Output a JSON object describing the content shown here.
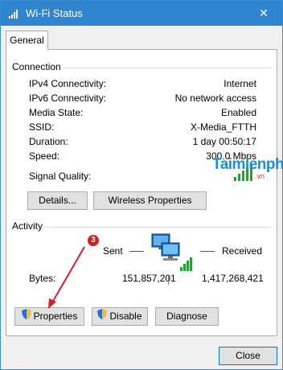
{
  "window": {
    "title": "Wi-Fi Status",
    "close_glyph": "✕"
  },
  "tabs": [
    {
      "label": "General"
    }
  ],
  "connection": {
    "heading": "Connection",
    "rows": [
      {
        "label": "IPv4 Connectivity:",
        "value": "Internet"
      },
      {
        "label": "IPv6 Connectivity:",
        "value": "No network access"
      },
      {
        "label": "Media State:",
        "value": "Enabled"
      },
      {
        "label": "SSID:",
        "value": "X-Media_FTTH"
      },
      {
        "label": "Duration:",
        "value": "1 day 00:50:17"
      },
      {
        "label": "Speed:",
        "value": "300.0 Mbps"
      }
    ],
    "signal_label": "Signal Quality:",
    "signal_bars": 5,
    "details_button": "Details...",
    "wireless_properties_button": "Wireless Properties"
  },
  "activity": {
    "heading": "Activity",
    "sent_label": "Sent",
    "received_label": "Received",
    "bytes_label": "Bytes:",
    "bytes_sent": "151,857,201",
    "bytes_received": "1,417,268,421"
  },
  "buttons": {
    "properties": "Properties",
    "disable": "Disable",
    "diagnose": "Diagnose",
    "close": "Close"
  },
  "annotation": {
    "step": "3"
  },
  "watermark": {
    "brand": "Taimienphi",
    "suffix": ".vn"
  },
  "colors": {
    "titlebar": "#2f86cf",
    "annotation_red": "#d21f26",
    "signal_green": "#2e9b3a"
  },
  "icons": [
    "wifi-status-icon",
    "signal-bars-icon",
    "network-computers-icon",
    "uac-shield-icon",
    "close-icon"
  ]
}
